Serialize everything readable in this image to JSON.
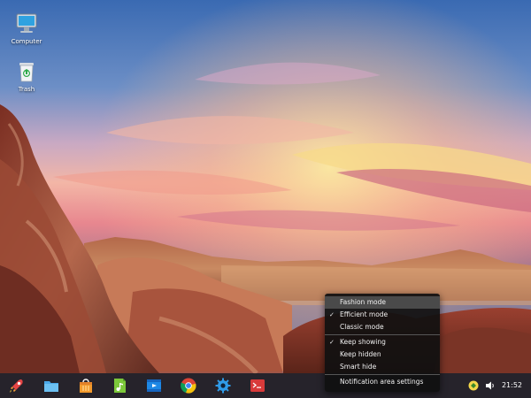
{
  "desktop": {
    "icons": [
      {
        "label": "Computer",
        "icon": "computer-icon"
      },
      {
        "label": "Trash",
        "icon": "trash-icon"
      }
    ]
  },
  "dock": {
    "apps": [
      {
        "name": "launcher",
        "icon": "rocket-icon"
      },
      {
        "name": "file-manager",
        "icon": "folder-icon"
      },
      {
        "name": "app-store",
        "icon": "shopping-bag-icon"
      },
      {
        "name": "music",
        "icon": "music-icon"
      },
      {
        "name": "video",
        "icon": "video-player-icon"
      },
      {
        "name": "browser",
        "icon": "chrome-icon"
      },
      {
        "name": "settings",
        "icon": "gear-icon"
      },
      {
        "name": "terminal",
        "icon": "terminal-icon"
      }
    ],
    "tray": {
      "network_icon": "network-icon",
      "volume_icon": "volume-icon"
    },
    "clock": "21:52"
  },
  "context_menu": {
    "sections": [
      {
        "items": [
          {
            "label": "Fashion mode",
            "checked": false,
            "highlighted": true
          },
          {
            "label": "Efficient mode",
            "checked": true,
            "highlighted": false
          },
          {
            "label": "Classic mode",
            "checked": false,
            "highlighted": false
          }
        ]
      },
      {
        "items": [
          {
            "label": "Keep showing",
            "checked": true,
            "highlighted": false
          },
          {
            "label": "Keep hidden",
            "checked": false,
            "highlighted": false
          },
          {
            "label": "Smart hide",
            "checked": false,
            "highlighted": false
          }
        ]
      },
      {
        "items": [
          {
            "label": "Notification area settings",
            "checked": false,
            "highlighted": false
          }
        ]
      }
    ]
  },
  "colors": {
    "sky_top": "#3b6db3",
    "sunset_pink": "#e87a8a",
    "sunset_yellow": "#f7dc8a",
    "rock": "#9a4a34",
    "menu_bg": "#101010",
    "menu_highlight": "#4a4a4a"
  }
}
